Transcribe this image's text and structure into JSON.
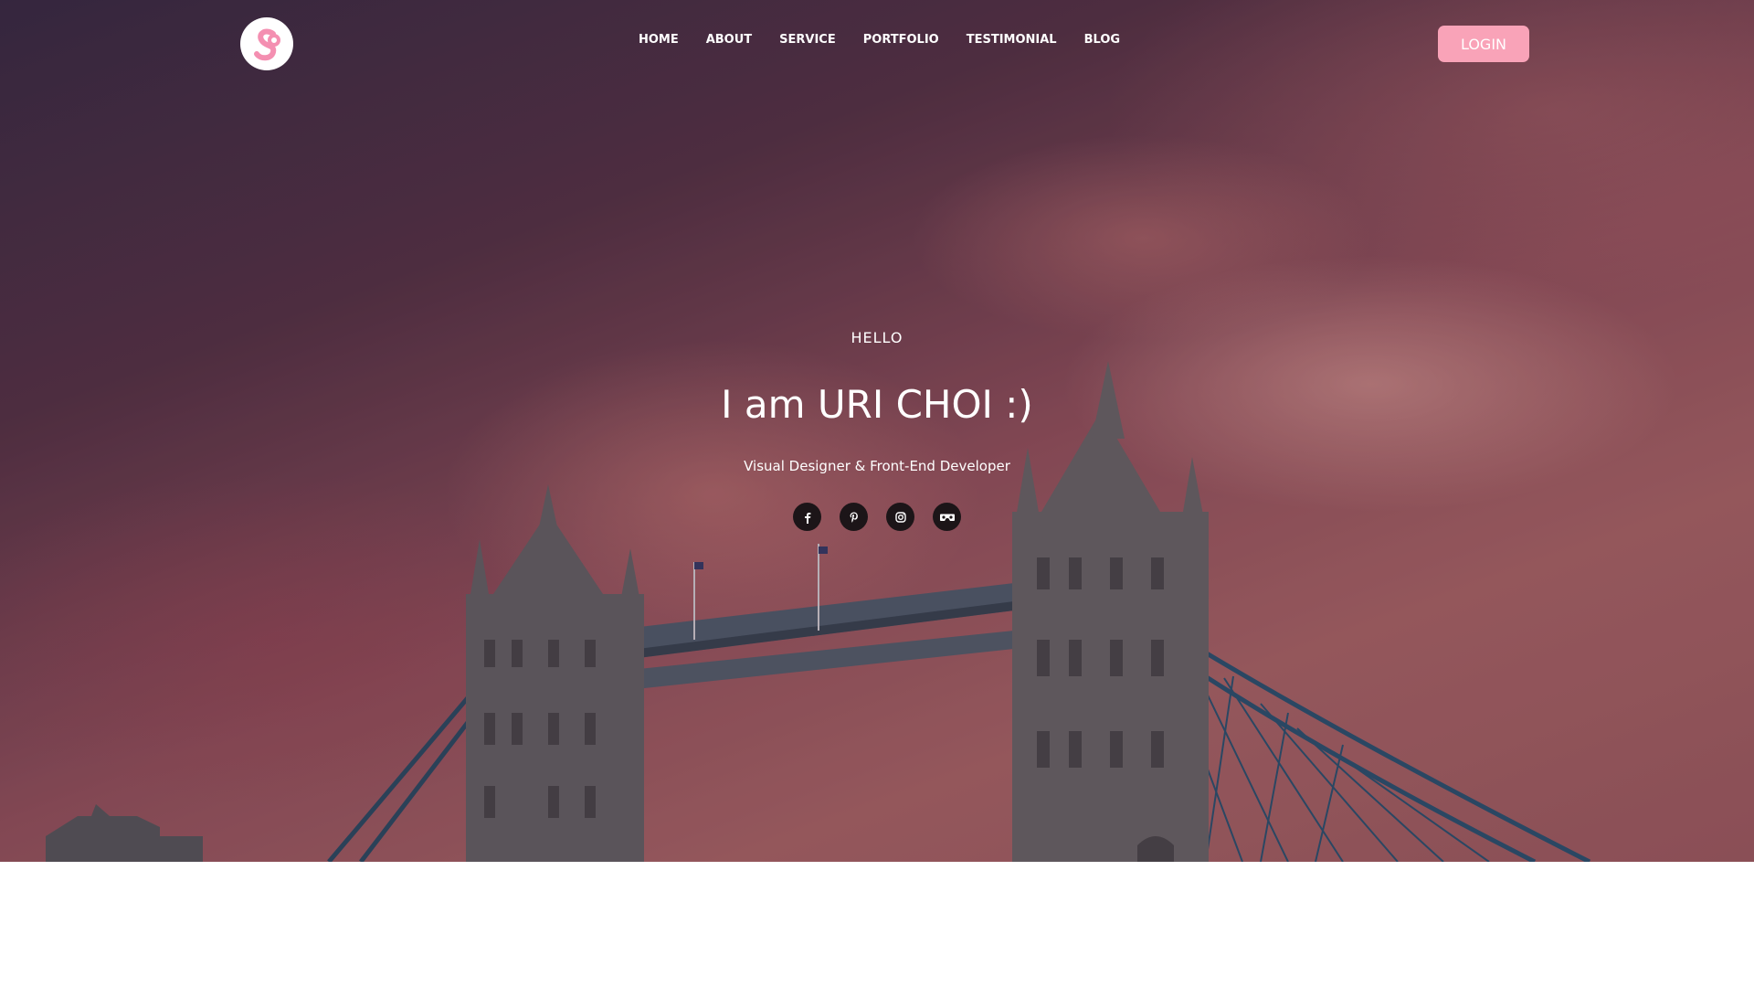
{
  "header": {
    "nav": [
      "HOME",
      "ABOUT",
      "SERVICE",
      "PORTFOLIO",
      "TESTIMONIAL",
      "BLOG"
    ],
    "login_label": "LOGIN"
  },
  "hero": {
    "greeting": "HELLO",
    "title": "I am URI CHOI :)",
    "subtitle": "Visual Designer & Front-End Developer",
    "socials": [
      "facebook-icon",
      "pinterest-icon",
      "instagram-icon",
      "vr-headset-icon"
    ]
  },
  "colors": {
    "accent": "#f9a3b8",
    "logo_bg": "#ffffff",
    "social_bg": "#1c1518"
  }
}
